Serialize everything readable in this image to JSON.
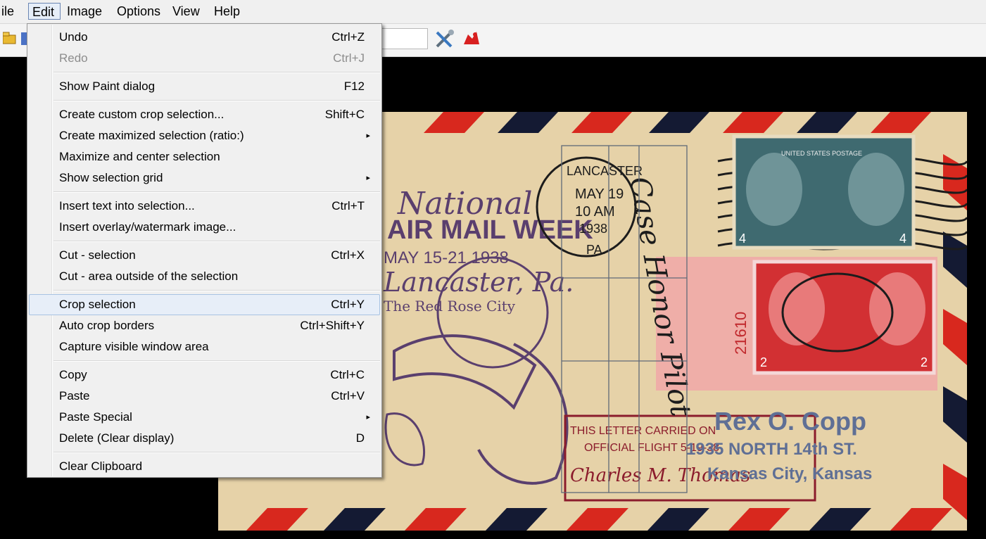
{
  "menubar": {
    "items": [
      {
        "label": "ile"
      },
      {
        "label": "Edit"
      },
      {
        "label": "Image"
      },
      {
        "label": "Options"
      },
      {
        "label": "View"
      },
      {
        "label": "Help"
      }
    ]
  },
  "toolbar": {
    "icons": [
      "open-folder-icon",
      "save-icon",
      "settings-tools-icon",
      "exit-icon"
    ],
    "zoom_value": ""
  },
  "edit_menu": {
    "items": [
      {
        "label": "Undo",
        "shortcut": "Ctrl+Z"
      },
      {
        "label": "Redo",
        "shortcut": "Ctrl+J",
        "disabled": true
      },
      {
        "label": "Show Paint dialog",
        "shortcut": "F12"
      },
      {
        "label": "Create custom crop selection...",
        "shortcut": "Shift+C"
      },
      {
        "label": "Create maximized selection (ratio:)",
        "submenu": true
      },
      {
        "label": "Maximize and center selection"
      },
      {
        "label": "Show selection grid",
        "submenu": true
      },
      {
        "label": "Insert text into selection...",
        "shortcut": "Ctrl+T"
      },
      {
        "label": "Insert overlay/watermark image..."
      },
      {
        "label": "Cut - selection",
        "shortcut": "Ctrl+X"
      },
      {
        "label": "Cut - area outside of the selection"
      },
      {
        "label": "Crop selection",
        "shortcut": "Ctrl+Y",
        "highlighted": true
      },
      {
        "label": "Auto crop borders",
        "shortcut": "Ctrl+Shift+Y"
      },
      {
        "label": "Capture visible window area"
      },
      {
        "label": "Copy",
        "shortcut": "Ctrl+C"
      },
      {
        "label": "Paste",
        "shortcut": "Ctrl+V"
      },
      {
        "label": "Paste Special",
        "submenu": true
      },
      {
        "label": "Delete (Clear display)",
        "shortcut": "D"
      },
      {
        "label": "Clear Clipboard"
      }
    ],
    "submenu_glyph": "▸"
  },
  "image": {
    "texts": {
      "national": "National",
      "air_mail_week": "AIR MAIL WEEK",
      "dates": "MAY 15-21 1938",
      "city_script": "Lancaster, Pa.",
      "red_rose_city": "The Red Rose City",
      "postmark_city": "LANCASTER",
      "postmark_date": "MAY 19",
      "postmark_time": "10 AM",
      "postmark_year": "1938",
      "postmark_state": "PA.",
      "stamp_top_banner": "UNITED STATES POSTAGE",
      "plate_number": "21610",
      "stamp_value_top": "4",
      "stamp_value_bottom": "2",
      "cachet_line1": "THIS LETTER CARRIED ON",
      "cachet_line2": "OFFICIAL FLIGHT 5-19-38",
      "signature": "Charles M. Thomas",
      "addressee": "Rex O. Copp",
      "street": "1935 NORTH 14th ST.",
      "city": "Kansas City, Kansas",
      "handwritten_vertical": "Case Honor Pilot"
    },
    "colors": {
      "paper": "#e6d2a8",
      "stripe_red": "#d8281e",
      "stripe_navy": "#141a33",
      "ink_purple": "#5a3f6e",
      "stamp_green": "#3f6a70",
      "stamp_red": "#d23033",
      "ink_black": "#1c1c1c"
    }
  }
}
